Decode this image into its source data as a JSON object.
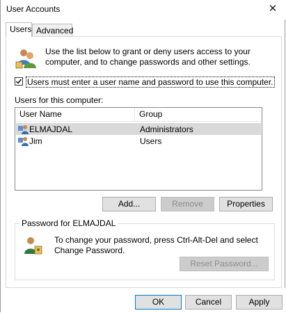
{
  "window": {
    "title": "User Accounts",
    "close_glyph": "✕"
  },
  "tabs": [
    {
      "label": "Users",
      "active": true
    },
    {
      "label": "Advanced",
      "active": false
    }
  ],
  "intro": {
    "icon": "users-icon",
    "text": "Use the list below to grant or deny users access to your computer, and to change passwords and other settings."
  },
  "require_login": {
    "checked": true,
    "label": "Users must enter a user name and password to use this computer."
  },
  "users_section": {
    "label": "Users for this computer:",
    "columns": [
      "User Name",
      "Group"
    ],
    "rows": [
      {
        "user": "ELMAJDAL",
        "group": "Administrators",
        "selected": true
      },
      {
        "user": "Jim",
        "group": "Users",
        "selected": false
      }
    ]
  },
  "list_buttons": {
    "add": "Add...",
    "remove": "Remove",
    "properties": "Properties"
  },
  "password_group": {
    "legend": "Password for ELMAJDAL",
    "icon": "password-user-icon",
    "text": "To change your password, press Ctrl-Alt-Del and select Change Password.",
    "reset": "Reset Password..."
  },
  "footer": {
    "ok": "OK",
    "cancel": "Cancel",
    "apply": "Apply"
  },
  "colors": {
    "accent": "#0078d7",
    "selected_row": "#d9d9d9",
    "button_bg": "#e1e1e1",
    "disabled_bg": "#cccccc"
  }
}
